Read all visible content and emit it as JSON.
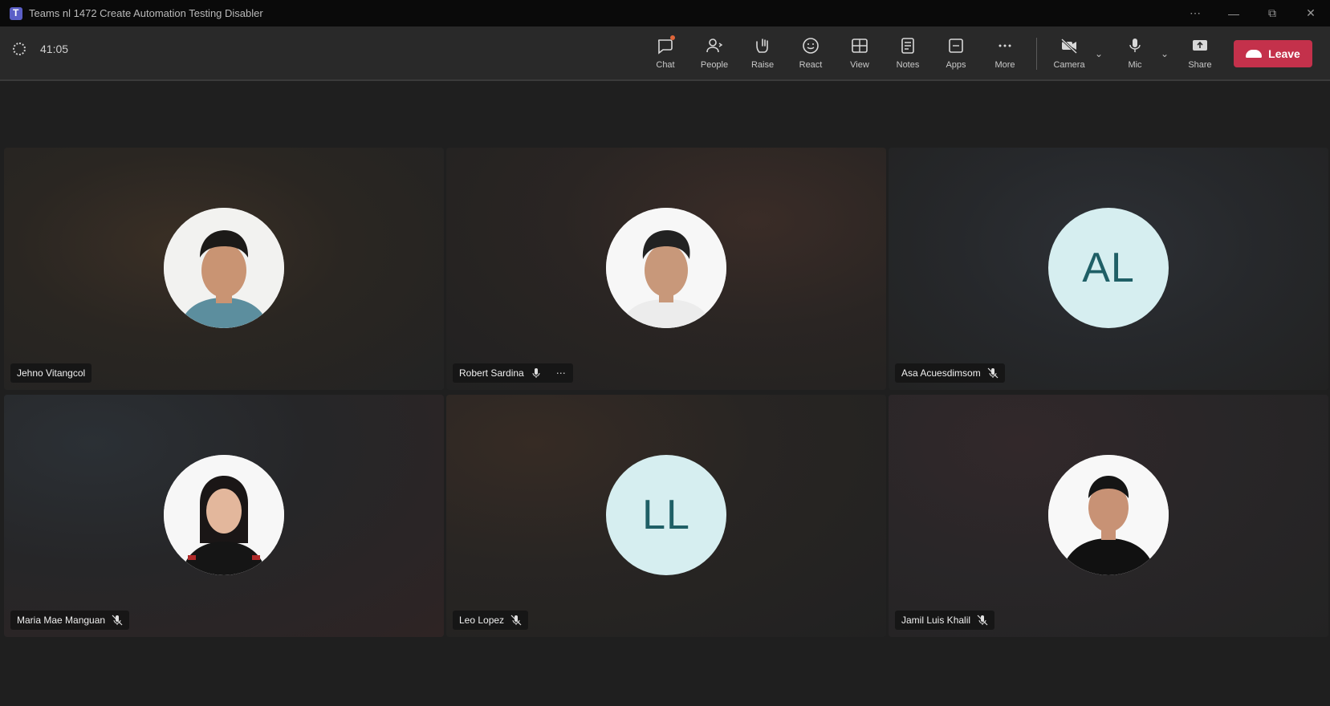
{
  "window": {
    "title": "Teams nl 1472 Create Automation Testing Disabler",
    "controls": [
      "⋯",
      "—",
      "⧉",
      "✕"
    ]
  },
  "toolbar": {
    "timer": "41:05",
    "items": [
      {
        "label": "Chat",
        "icon": "chat-icon"
      },
      {
        "label": "People",
        "icon": "people-icon"
      },
      {
        "label": "Raise",
        "icon": "raise-hand-icon"
      },
      {
        "label": "React",
        "icon": "react-icon"
      },
      {
        "label": "View",
        "icon": "view-icon"
      },
      {
        "label": "Notes",
        "icon": "notes-icon"
      },
      {
        "label": "Apps",
        "icon": "apps-icon"
      },
      {
        "label": "More",
        "icon": "more-icon"
      },
      {
        "label": "Camera",
        "icon": "camera-off-icon"
      },
      {
        "label": "Mic",
        "icon": "mic-icon"
      },
      {
        "label": "Share",
        "icon": "share-icon"
      }
    ],
    "leave_label": "Leave",
    "leave_color": "#c4314b"
  },
  "participants": [
    {
      "name": "Jehno Vitangcol",
      "avatar": "photo",
      "muted": false,
      "more": false
    },
    {
      "name": "Robert Sardina",
      "avatar": "photo",
      "muted": false,
      "more": true
    },
    {
      "name": "Asa Acuesdimsom",
      "avatar": "initials",
      "initials": "AL",
      "muted": true,
      "more": false
    },
    {
      "name": "Maria Mae Manguan",
      "avatar": "photo",
      "muted": true,
      "more": false
    },
    {
      "name": "Leo Lopez",
      "avatar": "initials",
      "initials": "LL",
      "muted": true,
      "more": false
    },
    {
      "name": "Jamil Luis Khalil",
      "avatar": "photo",
      "muted": true,
      "more": false
    }
  ],
  "colors": {
    "initials_bg": "#d6eef0",
    "initials_text": "#1f5f66",
    "stage_bg": "#1f1f1f"
  }
}
